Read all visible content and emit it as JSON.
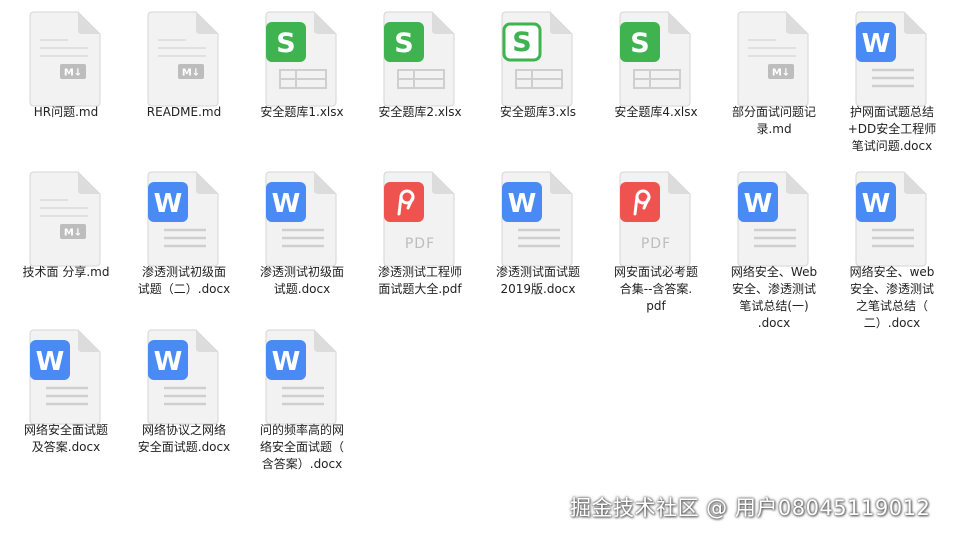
{
  "files": [
    [
      {
        "name": "HR问题.md",
        "icon": "markdown"
      },
      {
        "name": "README.md",
        "icon": "markdown"
      },
      {
        "name": "安全题库1.xlsx",
        "icon": "spreadsheet"
      },
      {
        "name": "安全题库2.xlsx",
        "icon": "spreadsheet"
      },
      {
        "name": "安全题库3.xls",
        "icon": "spreadsheet-outline"
      },
      {
        "name": "安全题库4.xlsx",
        "icon": "spreadsheet"
      },
      {
        "name": "部分面试问题记录.md",
        "icon": "markdown"
      },
      {
        "name": "护网面试题总结+DD安全工程师笔试问题.docx",
        "icon": "word"
      }
    ],
    [
      {
        "name": "技术面 分享.md",
        "icon": "markdown"
      },
      {
        "name": "渗透测试初级面试题（二）.docx",
        "icon": "word"
      },
      {
        "name": "渗透测试初级面试题.docx",
        "icon": "word"
      },
      {
        "name": "渗透测试工程师面试题大全.pdf",
        "icon": "pdf"
      },
      {
        "name": "渗透测试面试题2019版.docx",
        "icon": "word"
      },
      {
        "name": "网安面试必考题合集--含答案.pdf",
        "icon": "pdf"
      },
      {
        "name": "网络安全、Web安全、渗透测试笔试总结(一).docx",
        "icon": "word"
      },
      {
        "name": "网络安全、web安全、渗透测试之笔试总结（二）.docx",
        "icon": "word"
      }
    ],
    [
      {
        "name": "网络安全面试题及答案.docx",
        "icon": "word"
      },
      {
        "name": "网络协议之网络安全面试题.docx",
        "icon": "word"
      },
      {
        "name": "问的频率高的网络安全面试题（含答案）.docx",
        "icon": "word"
      }
    ]
  ],
  "icon_text": {
    "markdown": "M↓",
    "spreadsheet": "S",
    "word": "W",
    "pdf": "PDF"
  },
  "colors": {
    "spreadsheet": "#3fb34f",
    "word": "#4a8af4",
    "pdf": "#ef5350",
    "page": "#f2f2f2",
    "fold": "#dcdcdc",
    "markdown_badge": "#bdbdbd"
  },
  "watermark": "掘金技术社区 @ 用户08045119012"
}
